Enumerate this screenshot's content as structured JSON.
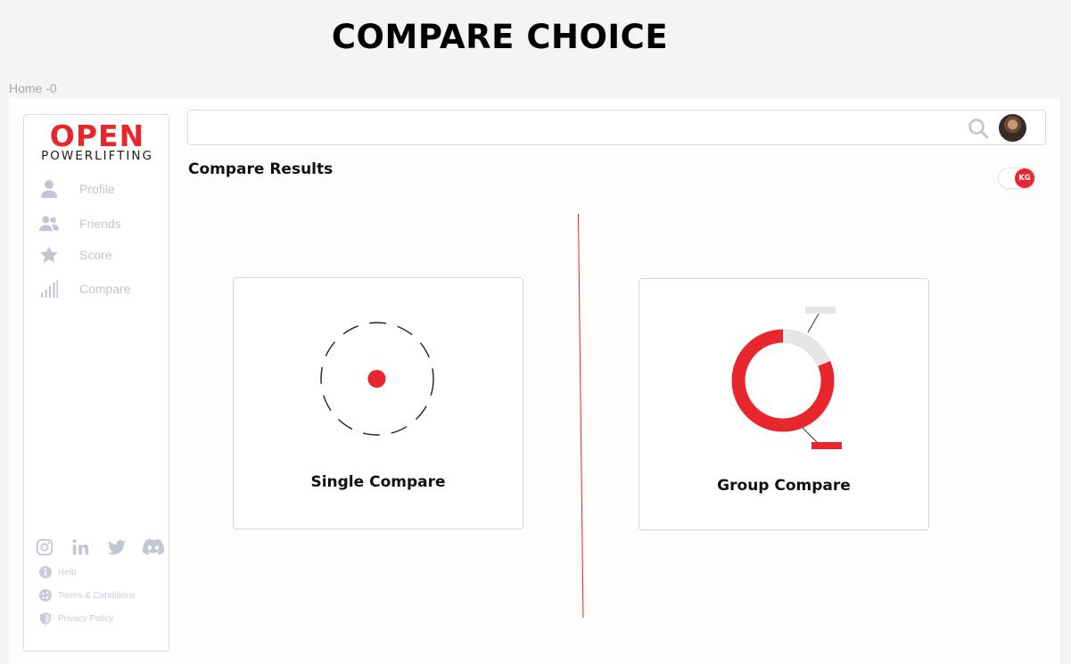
{
  "page_title": "COMPARE CHOICE",
  "frame_label": "Home -0",
  "brand": {
    "logo_top": "OPEN",
    "logo_bottom": "POWERLIFTING",
    "accent": "#e8262e"
  },
  "nav": [
    {
      "label": "Profile",
      "icon": "user-icon"
    },
    {
      "label": "Friends",
      "icon": "users-icon"
    },
    {
      "label": "Score",
      "icon": "star-icon"
    },
    {
      "label": "Compare",
      "icon": "bar-chart-icon"
    }
  ],
  "social": [
    "instagram-icon",
    "linkedin-icon",
    "twitter-icon",
    "discord-icon"
  ],
  "footer_links": [
    {
      "label": "Help",
      "icon": "info-icon"
    },
    {
      "label": "Terms & Conditions",
      "icon": "cookie-icon"
    },
    {
      "label": "Privacy Policy",
      "icon": "shield-icon"
    }
  ],
  "search": {
    "placeholder": ""
  },
  "section_title": "Compare Results",
  "unit_toggle": {
    "label": "KG",
    "on": true
  },
  "cards": [
    {
      "label": "Single Compare",
      "icon": "target-icon"
    },
    {
      "label": "Group Compare",
      "icon": "donut-icon"
    }
  ]
}
